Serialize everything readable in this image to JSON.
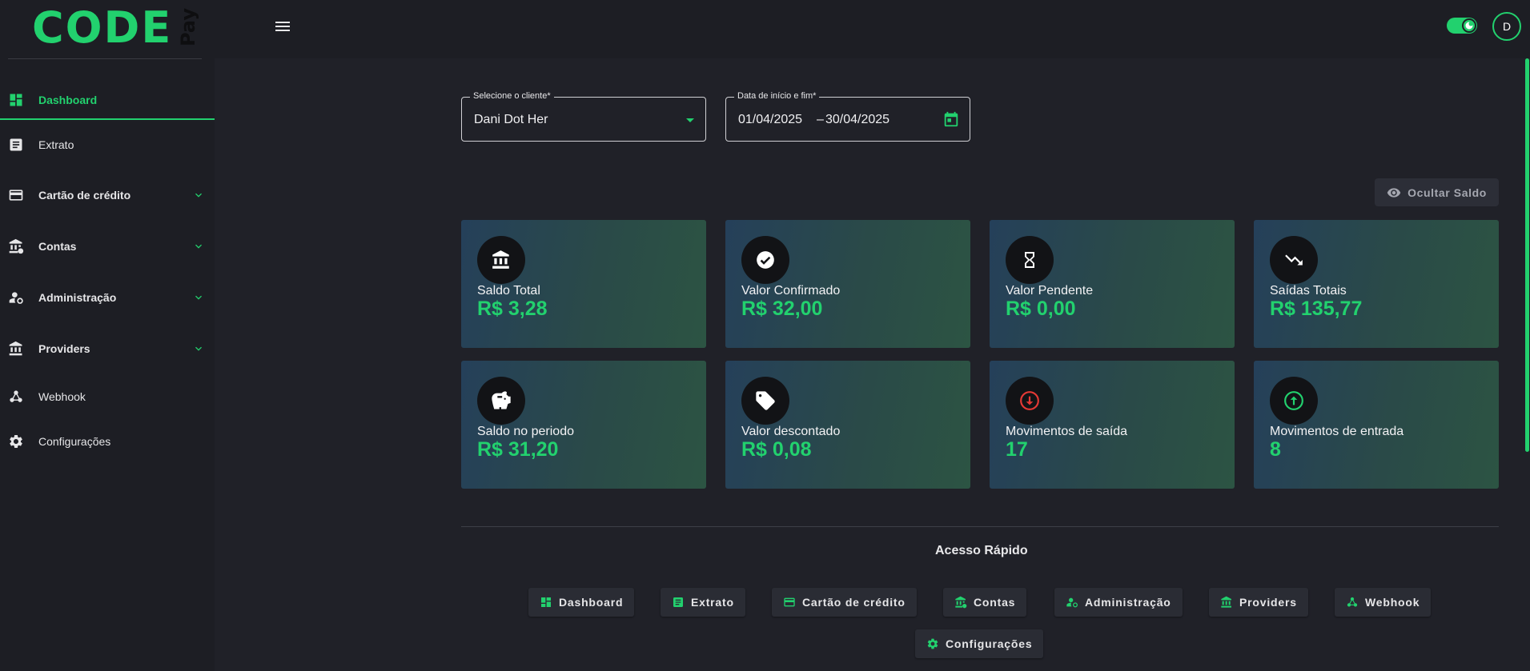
{
  "brand": {
    "code": "CODE",
    "pay": "Pay"
  },
  "colors": {
    "accent": "#22d16e",
    "background": "#202128",
    "sidebar": "#1d1e24",
    "danger": "#e53935"
  },
  "sidebar": {
    "items": [
      {
        "label": "Dashboard",
        "icon": "dashboard-icon"
      },
      {
        "label": "Extrato",
        "icon": "receipt-icon"
      },
      {
        "label": "Cartão de crédito",
        "icon": "credit-card-icon"
      },
      {
        "label": "Contas",
        "icon": "accounts-icon"
      },
      {
        "label": "Administração",
        "icon": "admin-icon"
      },
      {
        "label": "Providers",
        "icon": "bank-icon"
      },
      {
        "label": "Webhook",
        "icon": "webhook-icon"
      },
      {
        "label": "Configurações",
        "icon": "gear-icon"
      }
    ]
  },
  "header": {
    "avatar": "D",
    "theme_toggle": "dark-mode-toggle"
  },
  "filters": {
    "client": {
      "label": "Selecione o cliente*",
      "value": "Dani Dot Her"
    },
    "date": {
      "label": "Data de início e fim*",
      "start": "01/04/2025",
      "separator": "–",
      "end": "30/04/2025"
    }
  },
  "hide_balance_label": "Ocultar Saldo",
  "cards": [
    {
      "title": "Saldo Total",
      "value": "R$ 3,28",
      "icon": "bank-icon"
    },
    {
      "title": "Valor Confirmado",
      "value": "R$ 32,00",
      "icon": "check-circle-icon"
    },
    {
      "title": "Valor Pendente",
      "value": "R$ 0,00",
      "icon": "hourglass-icon"
    },
    {
      "title": "Saídas Totais",
      "value": "R$ 135,77",
      "icon": "trending-down-icon"
    },
    {
      "title": "Saldo no periodo",
      "value": "R$ 31,20",
      "icon": "piggy-bank-icon"
    },
    {
      "title": "Valor descontado",
      "value": "R$ 0,08",
      "icon": "discount-tag-icon"
    },
    {
      "title": "Movimentos de saída",
      "value": "17",
      "icon": "arrow-down-circle-icon"
    },
    {
      "title": "Movimentos de entrada",
      "value": "8",
      "icon": "arrow-up-circle-icon"
    }
  ],
  "quick_access": {
    "title": "Acesso Rápido",
    "buttons": [
      {
        "label": "Dashboard",
        "icon": "dashboard-icon"
      },
      {
        "label": "Extrato",
        "icon": "receipt-icon"
      },
      {
        "label": "Cartão de crédito",
        "icon": "credit-card-icon"
      },
      {
        "label": "Contas",
        "icon": "accounts-icon"
      },
      {
        "label": "Administração",
        "icon": "admin-icon"
      },
      {
        "label": "Providers",
        "icon": "bank-icon"
      },
      {
        "label": "Webhook",
        "icon": "webhook-icon"
      },
      {
        "label": "Configurações",
        "icon": "gear-icon"
      }
    ]
  }
}
